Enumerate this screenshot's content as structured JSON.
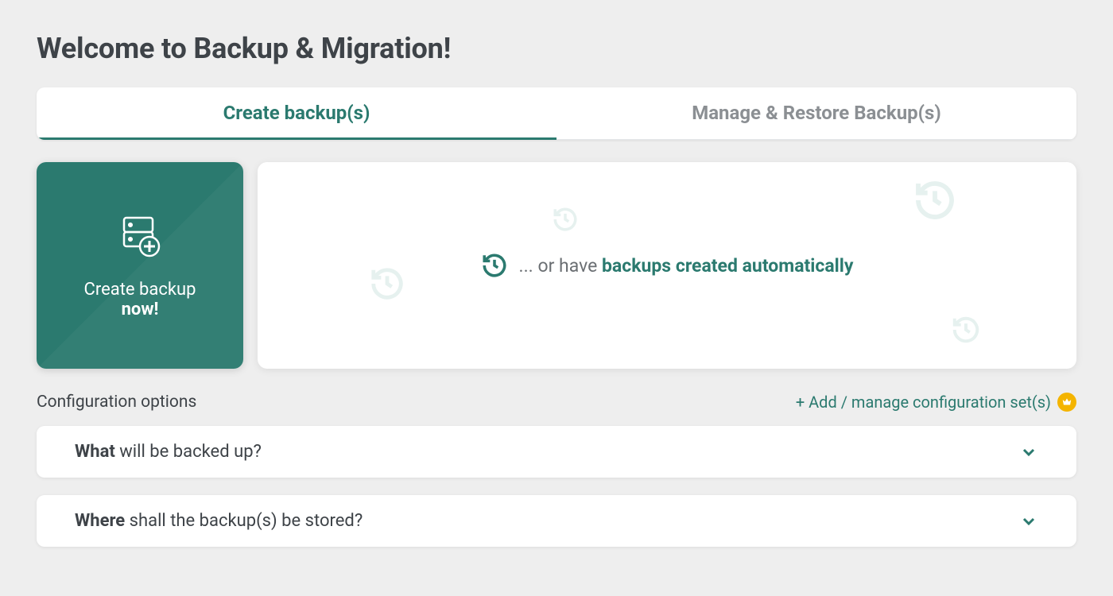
{
  "page_title": "Welcome to Backup & Migration!",
  "tabs": {
    "create": "Create backup(s)",
    "manage": "Manage & Restore Backup(s)"
  },
  "create_card": {
    "line1": "Create backup",
    "line2": "now!"
  },
  "auto_card": {
    "prefix": "... or have ",
    "bold": "backups created automatically"
  },
  "config": {
    "label": "Configuration options",
    "add_link": "+ Add / manage configuration set(s)"
  },
  "accordions": {
    "what": {
      "bold": "What",
      "rest": " will be backed up?"
    },
    "where": {
      "bold": "Where",
      "rest": " shall the backup(s) be stored?"
    }
  }
}
